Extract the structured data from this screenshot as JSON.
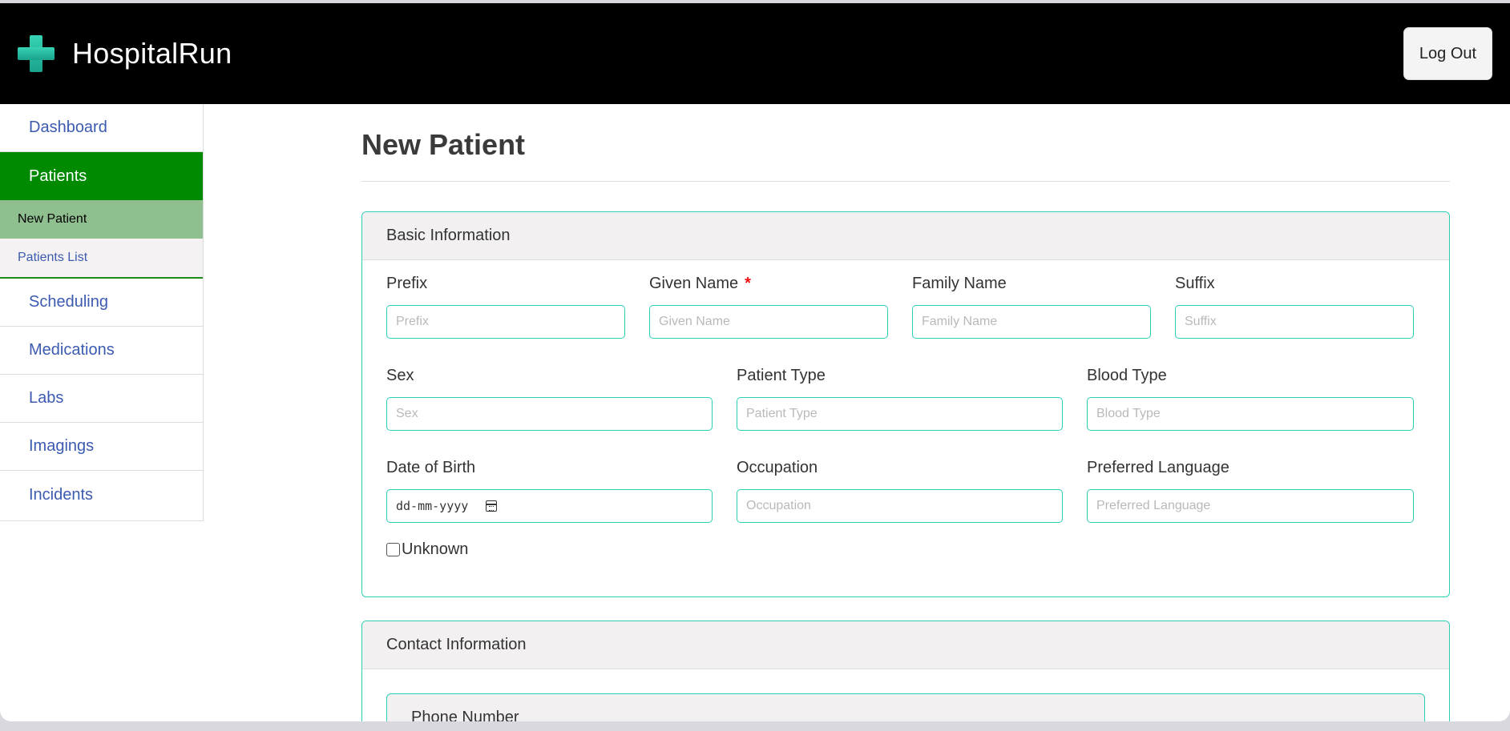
{
  "app": {
    "name": "HospitalRun",
    "logout_label": "Log Out"
  },
  "sidebar": {
    "items": [
      {
        "label": "Dashboard"
      },
      {
        "label": "Patients"
      },
      {
        "label": "Scheduling"
      },
      {
        "label": "Medications"
      },
      {
        "label": "Labs"
      },
      {
        "label": "Imagings"
      },
      {
        "label": "Incidents"
      }
    ],
    "patients_sub": [
      {
        "label": "New Patient"
      },
      {
        "label": "Patients List"
      }
    ]
  },
  "page": {
    "title": "New Patient"
  },
  "basic_info": {
    "header": "Basic Information",
    "prefix": {
      "label": "Prefix",
      "placeholder": "Prefix"
    },
    "given_name": {
      "label": "Given Name",
      "placeholder": "Given Name",
      "required_mark": "*"
    },
    "family_name": {
      "label": "Family Name",
      "placeholder": "Family Name"
    },
    "suffix": {
      "label": "Suffix",
      "placeholder": "Suffix"
    },
    "sex": {
      "label": "Sex",
      "placeholder": "Sex"
    },
    "patient_type": {
      "label": "Patient Type",
      "placeholder": "Patient Type"
    },
    "blood_type": {
      "label": "Blood Type",
      "placeholder": "Blood Type"
    },
    "dob": {
      "label": "Date of Birth",
      "value": "dd-mm-yyyy"
    },
    "occupation": {
      "label": "Occupation",
      "placeholder": "Occupation"
    },
    "preferred_language": {
      "label": "Preferred Language",
      "placeholder": "Preferred Language"
    },
    "unknown_label": "Unknown"
  },
  "contact_info": {
    "header": "Contact Information",
    "phone_header": "Phone Number"
  },
  "colors": {
    "accent": "#2ad0b4",
    "active_nav": "#008a00",
    "active_sub": "#8fbf8f",
    "link": "#3c5bb0"
  }
}
